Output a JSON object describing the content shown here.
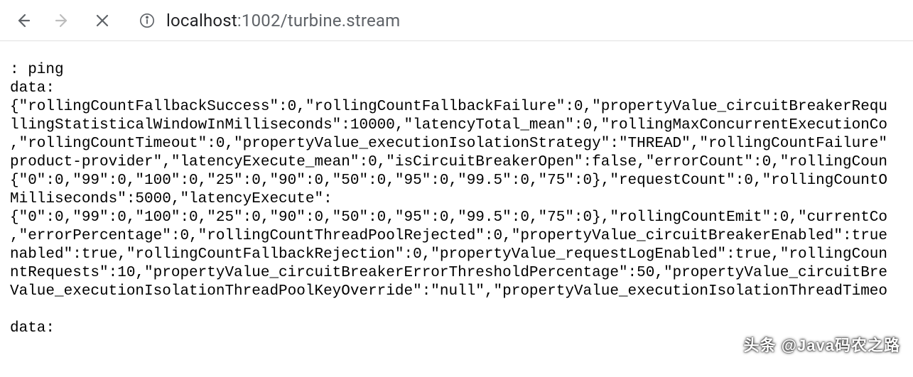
{
  "browser": {
    "url_host": "localhost",
    "url_port": ":1002",
    "url_path": "/turbine.stream"
  },
  "stream": {
    "line1": ": ping",
    "line2": "data:",
    "line3": "{\"rollingCountFallbackSuccess\":0,\"rollingCountFallbackFailure\":0,\"propertyValue_circuitBreakerRequ",
    "line4": "llingStatisticalWindowInMilliseconds\":10000,\"latencyTotal_mean\":0,\"rollingMaxConcurrentExecutionCo",
    "line5": ",\"rollingCountTimeout\":0,\"propertyValue_executionIsolationStrategy\":\"THREAD\",\"rollingCountFailure\"",
    "line6": "product-provider\",\"latencyExecute_mean\":0,\"isCircuitBreakerOpen\":false,\"errorCount\":0,\"rollingCoun",
    "line7": "{\"0\":0,\"99\":0,\"100\":0,\"25\":0,\"90\":0,\"50\":0,\"95\":0,\"99.5\":0,\"75\":0},\"requestCount\":0,\"rollingCountO",
    "line8": "Milliseconds\":5000,\"latencyExecute\":",
    "line9": "{\"0\":0,\"99\":0,\"100\":0,\"25\":0,\"90\":0,\"50\":0,\"95\":0,\"99.5\":0,\"75\":0},\"rollingCountEmit\":0,\"currentCo",
    "line10": ",\"errorPercentage\":0,\"rollingCountThreadPoolRejected\":0,\"propertyValue_circuitBreakerEnabled\":true",
    "line11": "nabled\":true,\"rollingCountFallbackRejection\":0,\"propertyValue_requestLogEnabled\":true,\"rollingCoun",
    "line12": "ntRequests\":10,\"propertyValue_circuitBreakerErrorThresholdPercentage\":50,\"propertyValue_circuitBre",
    "line13": "Value_executionIsolationThreadPoolKeyOverride\":\"null\",\"propertyValue_executionIsolationThreadTimeo",
    "line14": "",
    "line15": "data:"
  },
  "watermark": "头条 @Java码农之路"
}
